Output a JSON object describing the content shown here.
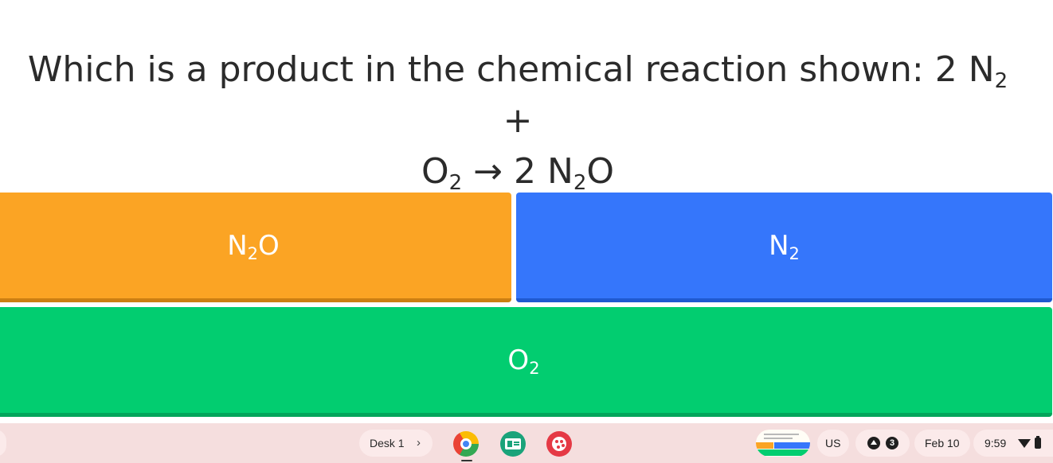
{
  "question": {
    "text_a": "Which is a product in the chemical reaction shown: 2 N",
    "sub_a": "2",
    "text_b": " +",
    "text_c": "O",
    "sub_c": "2",
    "text_d": " → 2 N",
    "sub_d": "2",
    "text_e": "O"
  },
  "answers": [
    {
      "base": "N",
      "sub": "2",
      "tail": "O",
      "color": "#fba424"
    },
    {
      "base": "N",
      "sub": "2",
      "tail": "",
      "color": "#3576fb"
    },
    {
      "base": "O",
      "sub": "2",
      "tail": "",
      "color": "#02cd70"
    }
  ],
  "shelf": {
    "desk_label": "Desk 1",
    "desk_chevron": "›",
    "apps": [
      "chrome-icon",
      "classroom-icon",
      "palette-icon"
    ],
    "keyboard_layout": "US",
    "notification_count": "3",
    "date": "Feb 10",
    "time": "9:59"
  }
}
